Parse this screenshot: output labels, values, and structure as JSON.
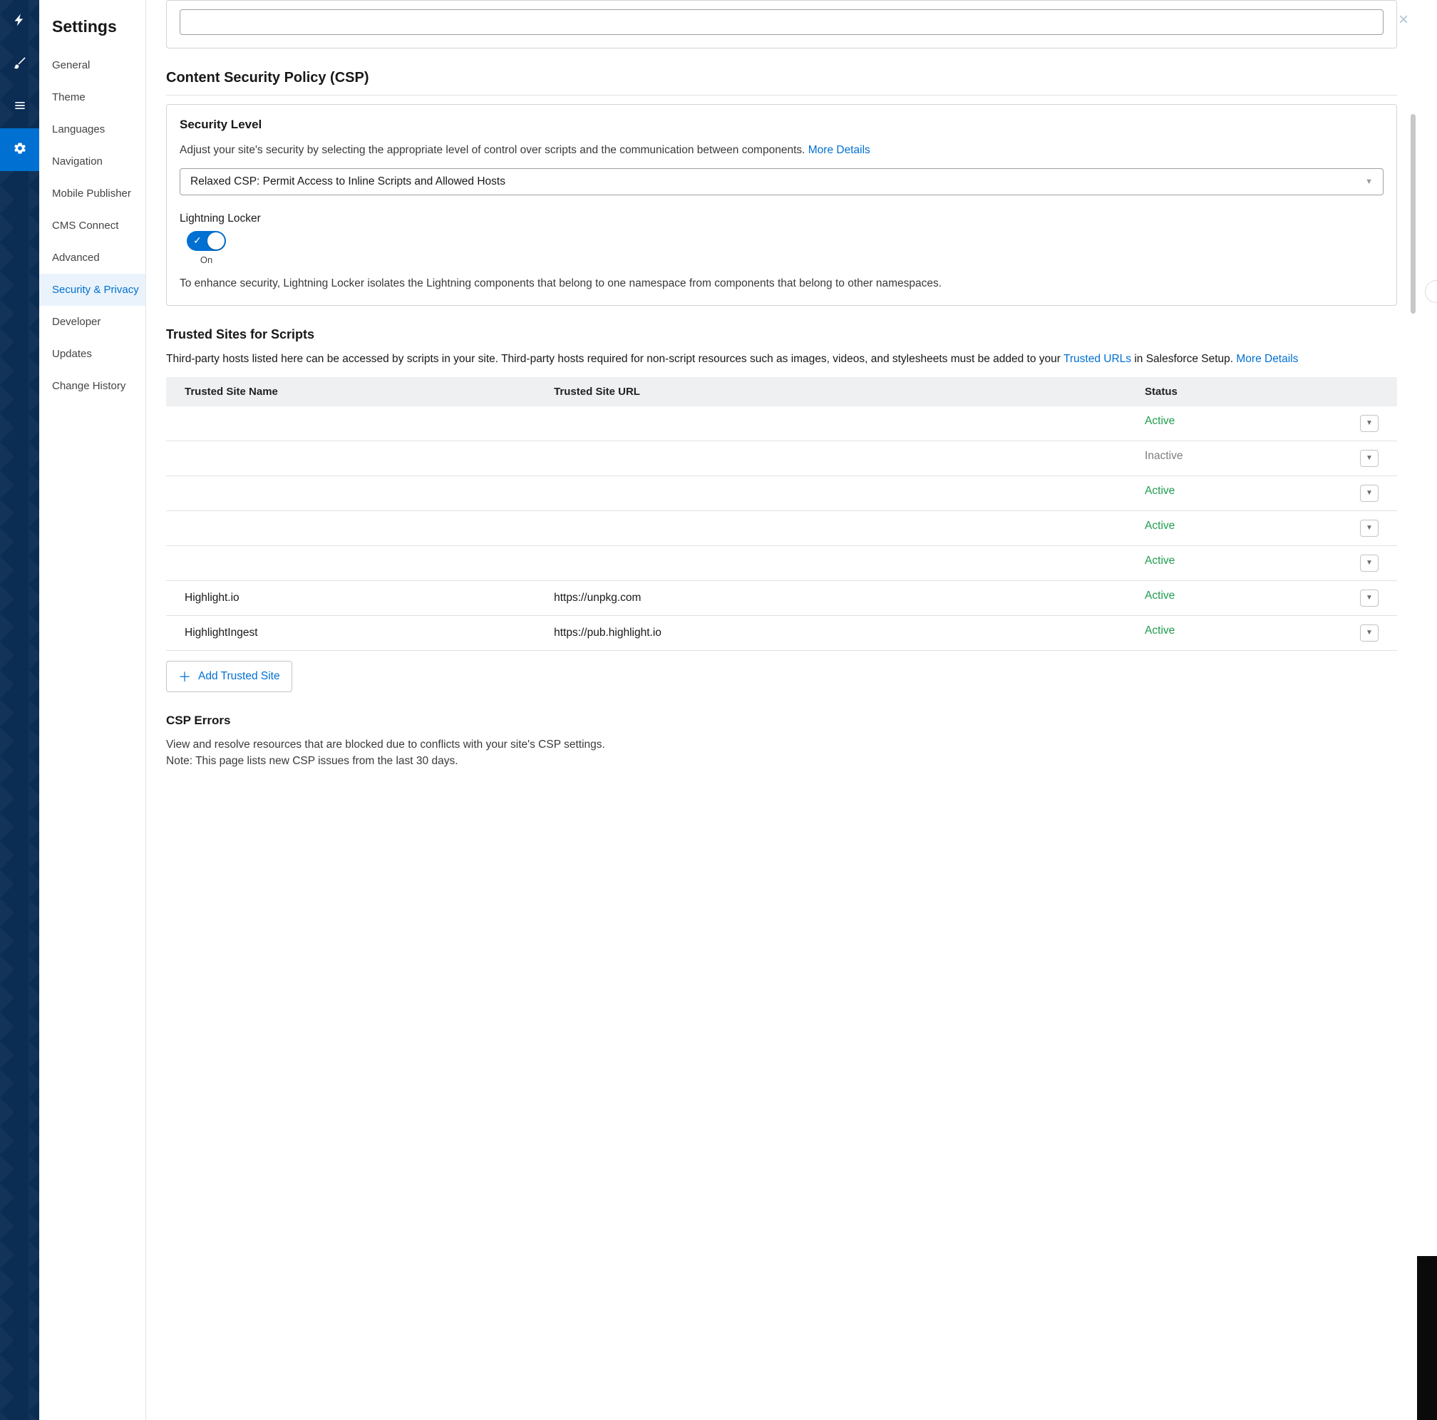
{
  "sidebar": {
    "title": "Settings",
    "items": [
      {
        "label": "General"
      },
      {
        "label": "Theme"
      },
      {
        "label": "Languages"
      },
      {
        "label": "Navigation"
      },
      {
        "label": "Mobile Publisher"
      },
      {
        "label": "CMS Connect"
      },
      {
        "label": "Advanced"
      },
      {
        "label": "Security & Privacy"
      },
      {
        "label": "Developer"
      },
      {
        "label": "Updates"
      },
      {
        "label": "Change History"
      }
    ],
    "active_index": 7
  },
  "csp": {
    "section_title": "Content Security Policy (CSP)",
    "security_level_heading": "Security Level",
    "security_level_desc": "Adjust your site's security by selecting the appropriate level of control over scripts and the communication between components.",
    "more_details": "More Details",
    "select_value": "Relaxed CSP: Permit Access to Inline Scripts and Allowed Hosts",
    "locker_label": "Lightning Locker",
    "locker_state": "On",
    "locker_desc": "To enhance security, Lightning Locker isolates the Lightning components that belong to one namespace from components that belong to other namespaces."
  },
  "trusted": {
    "heading": "Trusted Sites for Scripts",
    "desc_part1": "Third-party hosts listed here can be accessed by scripts in your site. Third-party hosts required for non-script resources such as images, videos, and stylesheets must be added to your ",
    "trusted_urls_link": "Trusted URLs",
    "desc_part2": " in Salesforce Setup. ",
    "more_details": "More Details",
    "cols": {
      "name": "Trusted Site Name",
      "url": "Trusted Site URL",
      "status": "Status"
    },
    "rows": [
      {
        "name": "",
        "url": "",
        "status": "Active"
      },
      {
        "name": "",
        "url": "",
        "status": "Inactive"
      },
      {
        "name": "",
        "url": "",
        "status": "Active"
      },
      {
        "name": "",
        "url": "",
        "status": "Active"
      },
      {
        "name": "",
        "url": "",
        "status": "Active"
      },
      {
        "name": "Highlight.io",
        "url": "https://unpkg.com",
        "status": "Active"
      },
      {
        "name": "HighlightIngest",
        "url": "https://pub.highlight.io",
        "status": "Active"
      }
    ],
    "add_label": "Add Trusted Site"
  },
  "csp_errors": {
    "heading": "CSP Errors",
    "line1": "View and resolve resources that are blocked due to conflicts with your site's CSP settings.",
    "line2": "Note: This page lists new CSP issues from the last 30 days."
  }
}
